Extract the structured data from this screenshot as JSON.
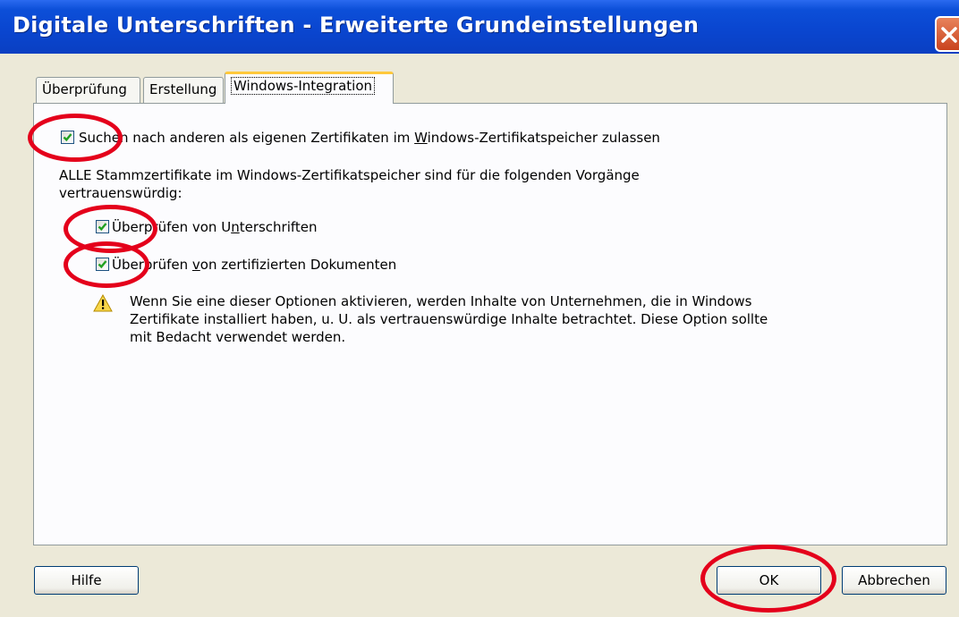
{
  "window": {
    "title": "Digitale Unterschriften - Erweiterte Grundeinstellungen",
    "close_icon": "close-icon"
  },
  "tabs": [
    {
      "label": "Überprüfung",
      "active": false
    },
    {
      "label": "Erstellung",
      "active": false
    },
    {
      "label": "Windows-Integration",
      "active": true
    }
  ],
  "options": {
    "search_certs": {
      "checked": true,
      "pre": "Suchen nach anderen als eigenen Zertifikaten im ",
      "mnemonic": "W",
      "post": "indows-Zertifikatspeicher zulassen"
    },
    "trust_text_line1": "ALLE Stammzertifikate im Windows-Zertifikatspeicher sind für die folgenden Vorgänge",
    "trust_text_line2": "vertrauenswürdig:",
    "verify_signatures": {
      "checked": true,
      "pre": "Überprüfen von U",
      "mnemonic": "n",
      "post": "terschriften"
    },
    "verify_certified": {
      "checked": true,
      "pre": "Überprüfen ",
      "mnemonic": "v",
      "post": "on zertifizierten Dokumenten"
    }
  },
  "warning": {
    "icon": "warning-icon",
    "line1": "Wenn Sie eine dieser Optionen aktivieren, werden Inhalte von Unternehmen, die in Windows",
    "line2": "Zertifikate installiert haben, u. U. als vertrauenswürdige Inhalte betrachtet. Diese Option sollte",
    "line3": "mit Bedacht verwendet werden."
  },
  "buttons": {
    "help": "Hilfe",
    "ok": "OK",
    "cancel": "Abbrechen"
  },
  "colors": {
    "titlebar": "#0a46d0",
    "annotation": "#e4001b",
    "active_tab_accent": "#ffc83c"
  }
}
